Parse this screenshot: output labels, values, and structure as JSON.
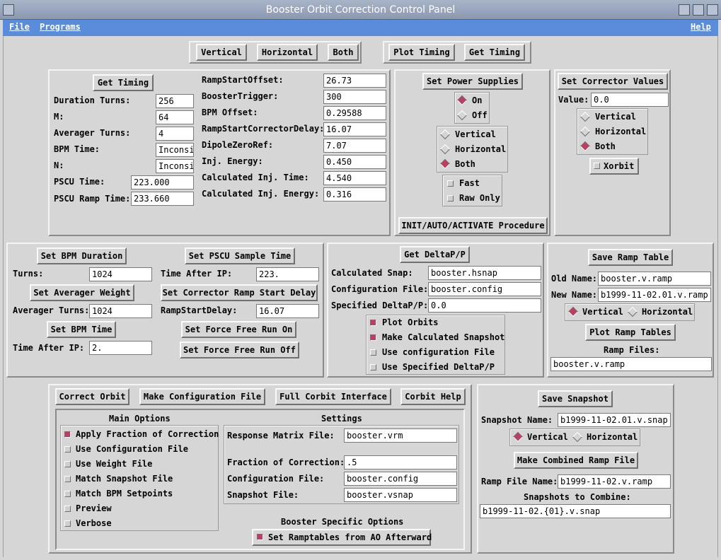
{
  "window": {
    "title": "Booster Orbit Correction Control Panel"
  },
  "menu": {
    "file": "File",
    "programs": "Programs",
    "help": "Help"
  },
  "topbar": {
    "vertical": "Vertical",
    "horizontal": "Horizontal",
    "both": "Both",
    "plot_timing": "Plot Timing",
    "get_timing": "Get Timing"
  },
  "timing": {
    "get_timing": "Get Timing",
    "duration_turns_label": "Duration Turns:",
    "duration_turns": "256",
    "m_label": "M:",
    "m": "64",
    "averager_turns_label": "Averager Turns:",
    "averager_turns": "4",
    "bpm_time_label": "BPM Time:",
    "bpm_time": "Inconsi",
    "n_label": "N:",
    "n": "Inconsi",
    "pscu_time_label": "PSCU Time:",
    "pscu_time": "223.000",
    "pscu_ramp_time_label": "PSCU Ramp Time:",
    "pscu_ramp_time": "233.660",
    "ramp_start_offset_label": "RampStartOffset:",
    "ramp_start_offset": "26.73",
    "booster_trigger_label": "BoosterTrigger:",
    "booster_trigger": "300",
    "bpm_offset_label": "BPM Offset:",
    "bpm_offset": "0.29588",
    "ramp_start_corrector_delay_label": "RampStartCorrectorDelay:",
    "ramp_start_corrector_delay": "16.07",
    "dipole_zero_ref_label": "DipoleZeroRef:",
    "dipole_zero_ref": "7.07",
    "inj_energy_label": "Inj. Energy:",
    "inj_energy": "0.450",
    "calc_inj_time_label": "Calculated Inj. Time:",
    "calc_inj_time": "4.540",
    "calc_inj_energy_label": "Calculated Inj. Energy:",
    "calc_inj_energy": "0.316"
  },
  "power": {
    "set_power_supplies": "Set Power Supplies",
    "on": "On",
    "off": "Off",
    "vertical": "Vertical",
    "horizontal": "Horizontal",
    "both": "Both",
    "fast": "Fast",
    "raw_only": "Raw Only",
    "init": "INIT/AUTO/ACTIVATE Procedure"
  },
  "corrector": {
    "set_values": "Set Corrector Values",
    "value_label": "Value:",
    "value": "0.0",
    "vertical": "Vertical",
    "horizontal": "Horizontal",
    "both": "Both",
    "xorbit": "Xorbit"
  },
  "bpm": {
    "set_bpm_duration": "Set BPM Duration",
    "turns_label": "Turns:",
    "turns": "1024",
    "set_averager_weight": "Set Averager Weight",
    "averager_turns_label": "Averager Turns:",
    "averager_turns": "1024",
    "set_bpm_time": "Set BPM Time",
    "time_after_ip_label": "Time After IP:",
    "time_after_ip": "2.",
    "set_pscu_sample_time": "Set PSCU Sample Time",
    "pscu_time_after_ip_label": "Time After IP:",
    "pscu_time_after_ip": "223.",
    "set_corrector_ramp_start_delay": "Set Corrector Ramp Start Delay",
    "ramp_start_delay_label": "RampStartDelay:",
    "ramp_start_delay": "16.07",
    "set_force_free_run_on": "Set Force Free Run On",
    "set_force_free_run_off": "Set Force Free Run Off"
  },
  "delta": {
    "get_delta": "Get DeltaP/P",
    "calc_snap_label": "Calculated Snap:",
    "calc_snap": "booster.hsnap",
    "config_file_label": "Configuration File:",
    "config_file": "booster.config",
    "specified_label": "Specified DeltaP/P:",
    "specified": "0.0",
    "plot_orbits": "Plot Orbits",
    "make_calc_snapshot": "Make Calculated Snapshot",
    "use_config_file": "Use configuration File",
    "use_specified": "Use Specified DeltaP/P"
  },
  "ramp": {
    "save_ramp_table": "Save Ramp Table",
    "old_name_label": "Old Name:",
    "old_name": "booster.v.ramp",
    "new_name_label": "New Name:",
    "new_name": "b1999-11-02.01.v.ramp",
    "vertical": "Vertical",
    "horizontal": "Horizontal",
    "plot_ramp_tables": "Plot Ramp Tables",
    "ramp_files_label": "Ramp Files:",
    "ramp_files": "booster.v.ramp"
  },
  "orbit": {
    "correct_orbit": "Correct Orbit",
    "make_config_file": "Make Configuration File",
    "full_interface": "Full Corbit Interface",
    "help": "Corbit Help",
    "main_options": "Main Options",
    "settings": "Settings",
    "apply_fraction": "Apply Fraction of Correction",
    "use_config": "Use Configuration File",
    "use_weight": "Use Weight File",
    "match_snapshot": "Match Snapshot File",
    "match_bpm": "Match BPM Setpoints",
    "preview": "Preview",
    "verbose": "Verbose",
    "response_matrix_label": "Response Matrix File:",
    "response_matrix": "booster.vrm",
    "fraction_label": "Fraction of Correction:",
    "fraction": ".5",
    "config_file_label": "Configuration File:",
    "config_file": "booster.config",
    "snapshot_file_label": "Snapshot File:",
    "snapshot_file": "booster.vsnap",
    "booster_specific": "Booster Specific Options",
    "set_ramptables": "Set Ramptables from AO Afterward"
  },
  "snapshot": {
    "save_snapshot": "Save Snapshot",
    "snapshot_name_label": "Snapshot Name:",
    "snapshot_name": "b1999-11-02.01.v.snap",
    "vertical": "Vertical",
    "horizontal": "Horizontal",
    "make_combined": "Make Combined Ramp File",
    "ramp_file_name_label": "Ramp File Name:",
    "ramp_file_name": "b1999-11-02.v.ramp",
    "snapshots_to_combine_label": "Snapshots to Combine:",
    "snapshots_to_combine": "b1999-11-02.{01}.v.snap"
  },
  "colors": {
    "menubar": "#5a8cdc",
    "titlebar": "#8c98ae",
    "indicator": "#b84060",
    "background": "#d6d6d6"
  }
}
